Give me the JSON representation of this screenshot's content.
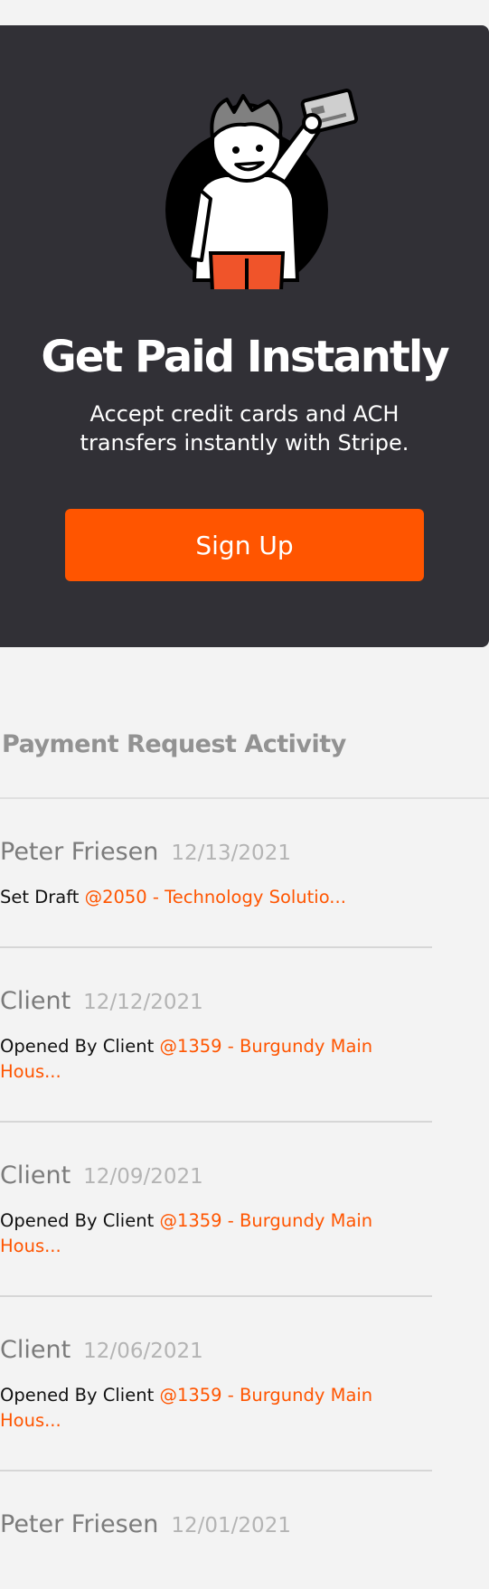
{
  "promo": {
    "title": "Get Paid Instantly",
    "subtitle": "Accept credit cards and ACH transfers instantly with Stripe.",
    "signup_label": "Sign Up",
    "illustration_icon": "person-holding-credit-card-illustration",
    "accent_color": "#ff5500",
    "background_color": "#313036"
  },
  "activity": {
    "title": "Payment Request Activity",
    "items": [
      {
        "name": "Peter Friesen",
        "date": "12/13/2021",
        "action": "Set Draft",
        "link": "@2050 - Technology Solutio..."
      },
      {
        "name": "Client",
        "date": "12/12/2021",
        "action": "Opened By Client",
        "link": "@1359 - Burgundy Main Hous..."
      },
      {
        "name": "Client",
        "date": "12/09/2021",
        "action": "Opened By Client",
        "link": "@1359 - Burgundy Main Hous..."
      },
      {
        "name": "Client",
        "date": "12/06/2021",
        "action": "Opened By Client",
        "link": "@1359 - Burgundy Main Hous..."
      },
      {
        "name": "Peter Friesen",
        "date": "12/01/2021",
        "action": "",
        "link": ""
      }
    ]
  }
}
